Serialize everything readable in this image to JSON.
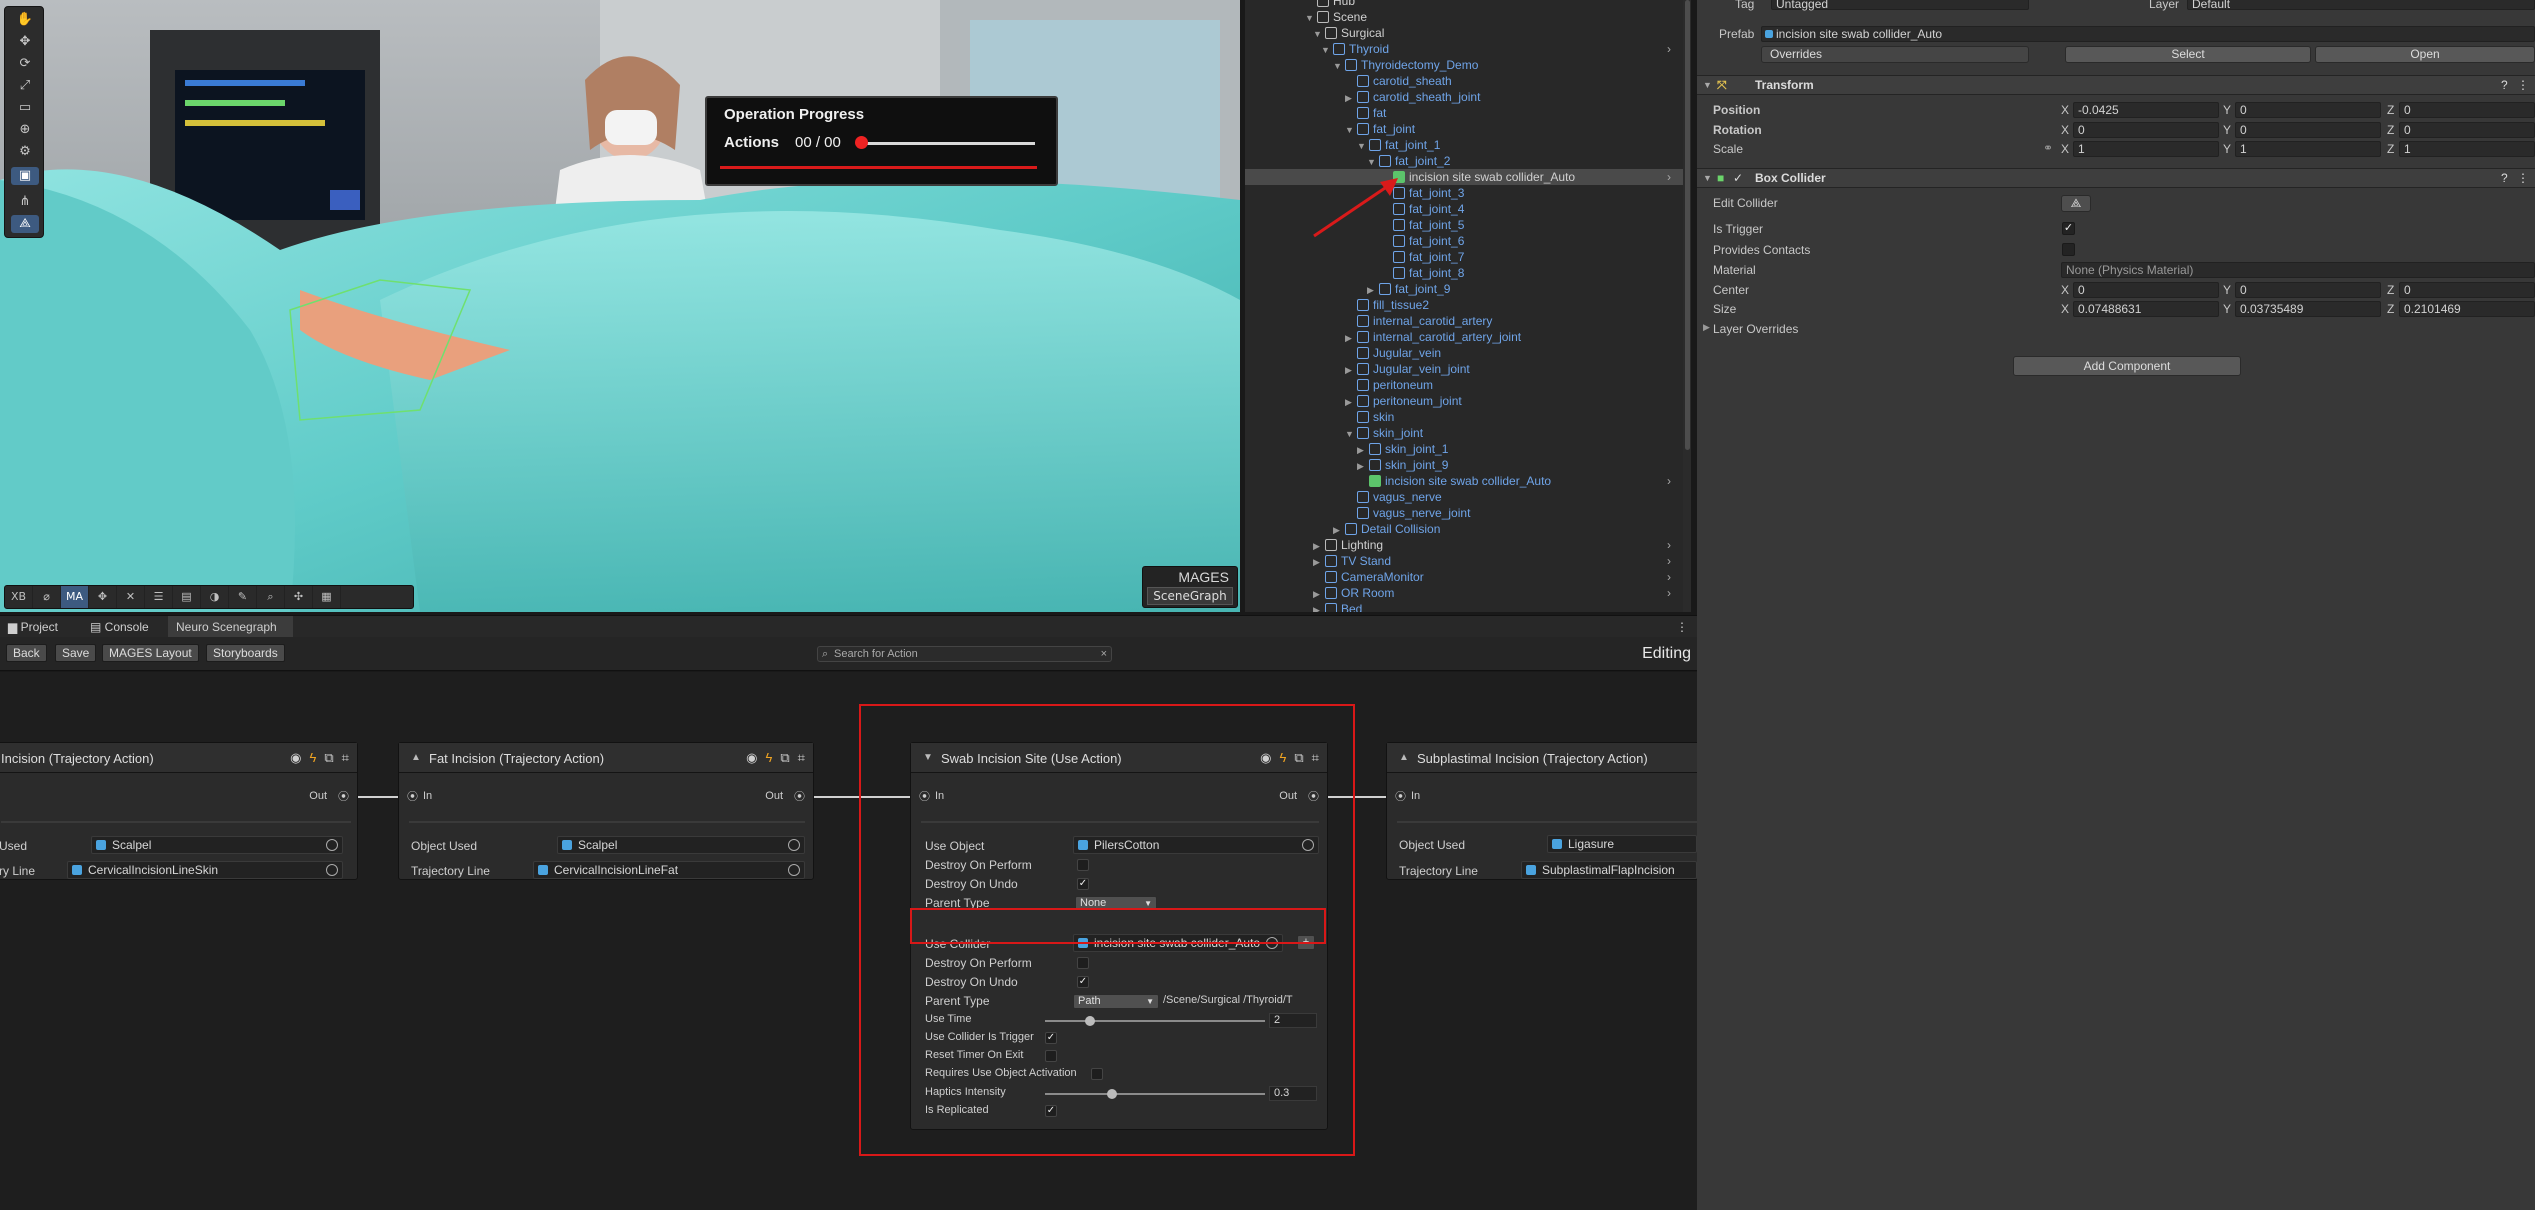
{
  "scene_view": {
    "operation_progress": {
      "title": "Operation Progress",
      "actions_label": "Actions",
      "actions_count": "00 / 00",
      "progress": 0
    },
    "tool_buttons": [
      "XB",
      "MA"
    ],
    "mages_label": "MAGES",
    "scenegraph_button": "SceneGraph",
    "accent_red": "#d91a1a"
  },
  "hierarchy": {
    "items": [
      {
        "label": "Hub",
        "blue": false
      },
      {
        "label": "Scene",
        "blue": false
      },
      {
        "label": "Surgical",
        "blue": false
      },
      {
        "label": "Thyroid",
        "blue": true
      },
      {
        "label": "Thyroidectomy_Demo",
        "blue": true
      },
      {
        "label": "carotid_sheath",
        "blue": true
      },
      {
        "label": "carotid_sheath_joint",
        "blue": true
      },
      {
        "label": "fat",
        "blue": true
      },
      {
        "label": "fat_joint",
        "blue": true
      },
      {
        "label": "fat_joint_1",
        "blue": true
      },
      {
        "label": "fat_joint_2",
        "blue": true
      },
      {
        "label": "incision site swab collider_Auto",
        "blue": false
      },
      {
        "label": "fat_joint_3",
        "blue": true
      },
      {
        "label": "fat_joint_4",
        "blue": true
      },
      {
        "label": "fat_joint_5",
        "blue": true
      },
      {
        "label": "fat_joint_6",
        "blue": true
      },
      {
        "label": "fat_joint_7",
        "blue": true
      },
      {
        "label": "fat_joint_8",
        "blue": true
      },
      {
        "label": "fat_joint_9",
        "blue": true
      },
      {
        "label": "fill_tissue2",
        "blue": true
      },
      {
        "label": "internal_carotid_artery",
        "blue": true
      },
      {
        "label": "internal_carotid_artery_joint",
        "blue": true
      },
      {
        "label": "Jugular_vein",
        "blue": true
      },
      {
        "label": "Jugular_vein_joint",
        "blue": true
      },
      {
        "label": "peritoneum",
        "blue": true
      },
      {
        "label": "peritoneum_joint",
        "blue": true
      },
      {
        "label": "skin",
        "blue": true
      },
      {
        "label": "skin_joint",
        "blue": true
      },
      {
        "label": "skin_joint_1",
        "blue": true
      },
      {
        "label": "skin_joint_9",
        "blue": true
      },
      {
        "label": "incision site swab collider_Auto",
        "blue": true
      },
      {
        "label": "vagus_nerve",
        "blue": true
      },
      {
        "label": "vagus_nerve_joint",
        "blue": true
      },
      {
        "label": "Detail Collision",
        "blue": true
      },
      {
        "label": "Lighting",
        "blue": false
      },
      {
        "label": "TV Stand",
        "blue": true
      },
      {
        "label": "CameraMonitor",
        "blue": true
      },
      {
        "label": "OR Room",
        "blue": true
      },
      {
        "label": "Bed",
        "blue": true
      }
    ]
  },
  "inspector": {
    "tag_label": "Tag",
    "tag_value": "Untagged",
    "layer_label": "Layer",
    "layer_value": "Default",
    "prefab_label": "Prefab",
    "prefab_value": "incision site swab collider_Auto",
    "overrides": "Overrides",
    "select_btn": "Select",
    "open_btn": "Open",
    "transform": {
      "title": "Transform",
      "position_label": "Position",
      "rotation_label": "Rotation",
      "scale_label": "Scale",
      "position": [
        "-0.0425",
        "0",
        "0"
      ],
      "rotation": [
        "0",
        "0",
        "0"
      ],
      "scale": [
        "1",
        "1",
        "1"
      ]
    },
    "box_collider": {
      "title": "Box Collider",
      "edit_collider": "Edit Collider",
      "is_trigger": "Is Trigger",
      "provides_contacts": "Provides Contacts",
      "material": "Material",
      "material_value": "None (Physics Material)",
      "center": "Center",
      "center_values": [
        "0",
        "0",
        "0"
      ],
      "size": "Size",
      "size_values": [
        "0.07488631",
        "0.03735489",
        "0.2101469"
      ],
      "layer_overrides": "Layer Overrides"
    },
    "add_component": "Add Component",
    "axes": [
      "X",
      "Y",
      "Z"
    ]
  },
  "bottom_tabs": [
    "Project",
    "Console",
    "Neuro Scenegraph"
  ],
  "toolbar": {
    "back": "Back",
    "save": "Save",
    "mages_layout": "MAGES Layout",
    "storyboards": "Storyboards",
    "search_placeholder": "Search for Action",
    "mode": "Editing"
  },
  "graph": {
    "node1": {
      "title": "Incision (Trajectory Action)",
      "out": "Out",
      "object_label": "Used",
      "object_value": "Scalpel",
      "traj_label": "ry Line",
      "traj_value": "CervicalIncisionLineSkin"
    },
    "node2": {
      "title": "Fat Incision (Trajectory Action)",
      "in": "In",
      "out": "Out",
      "object_label": "Object Used",
      "object_value": "Scalpel",
      "traj_label": "Trajectory Line",
      "traj_value": "CervicalIncisionLineFat"
    },
    "node3": {
      "title": "Swab Incision Site (Use Action)",
      "in": "In",
      "out": "Out",
      "use_object": "Use Object",
      "use_object_value": "PilersCotton",
      "destroy_on_perform": "Destroy On Perform",
      "destroy_on_undo": "Destroy On Undo",
      "parent_type": "Parent Type",
      "parent_type_value": "None",
      "use_collider": "Use Collider",
      "use_collider_value": "incision site swab collider_Auto",
      "destroy_on_perform2": "Destroy On Perform",
      "destroy_on_undo2": "Destroy On Undo",
      "parent_type2": "Parent Type",
      "parent_type2_value": "Path",
      "parent_path": "/Scene/Surgical /Thyroid/T",
      "use_time": "Use Time",
      "use_time_value": "2",
      "use_collider_trigger": "Use Collider Is Trigger",
      "reset_timer": "Reset Timer On Exit",
      "requires_activation": "Requires Use Object Activation",
      "haptics": "Haptics Intensity",
      "haptics_value": "0.3",
      "replicated": "Is Replicated"
    },
    "node4": {
      "title": "Subplastimal Incision (Trajectory Action)",
      "in": "In",
      "object_label": "Object Used",
      "object_value": "Ligasure",
      "traj_label": "Trajectory Line",
      "traj_value": "SubplastimalFlapIncision"
    }
  }
}
